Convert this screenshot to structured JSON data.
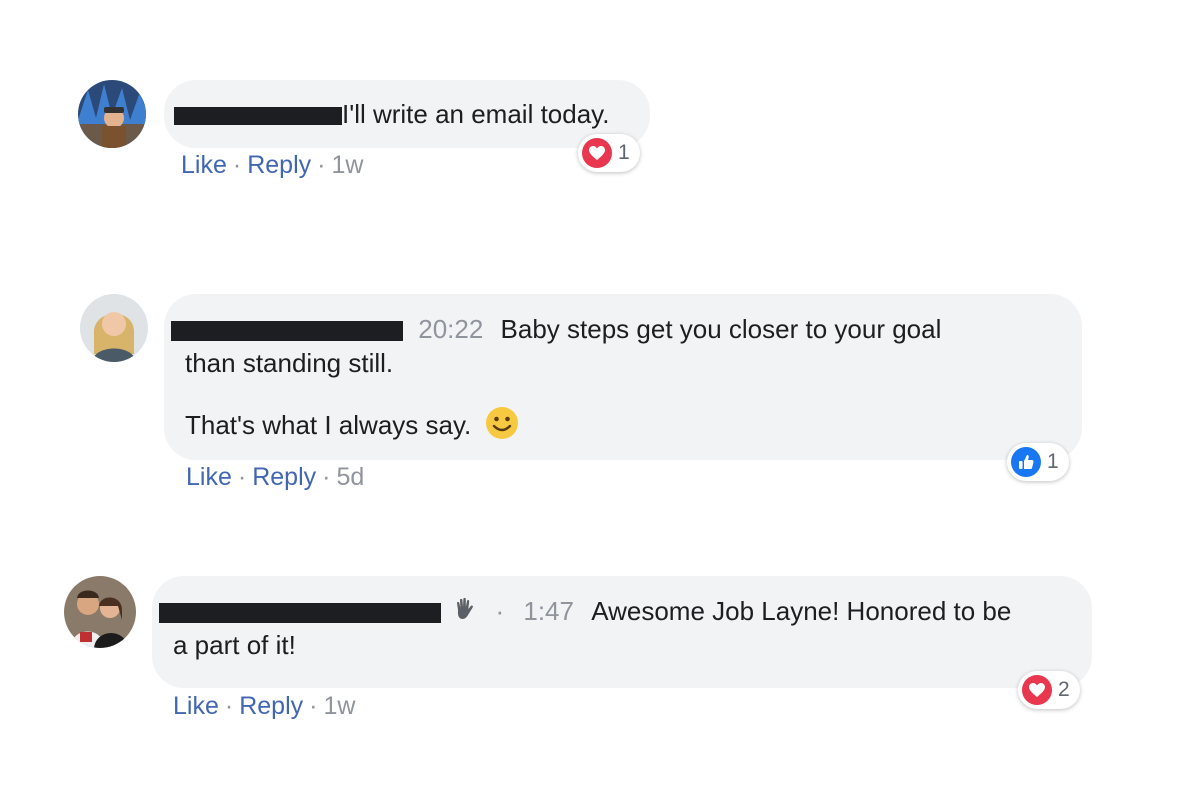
{
  "colors": {
    "bubble_bg": "#f2f3f5",
    "link": "#4267b2",
    "muted": "#90949c",
    "love_red": "#e8374e",
    "like_blue": "#1877f2"
  },
  "comments": [
    {
      "text": "I'll write an email today.",
      "actions": {
        "like": "Like",
        "reply": "Reply",
        "sep": "·",
        "time": "1w"
      },
      "reaction": {
        "icon": "love-icon",
        "count": "1"
      }
    },
    {
      "timestamp": "20:22",
      "text_line1": "Baby steps get you closer to your goal",
      "text_line2": "than standing still.",
      "text_line3": "That's what I always say.",
      "emoji": "slightly-smiling-face-emoji",
      "actions": {
        "like": "Like",
        "reply": "Reply",
        "sep": "·",
        "time": "5d"
      },
      "reaction": {
        "icon": "like-icon",
        "count": "1"
      }
    },
    {
      "badge_icon": "waving-hand-icon",
      "badge_sep": "·",
      "timestamp": "1:47",
      "text_line1": "Awesome Job Layne! Honored to be",
      "text_line2": "a part of it!",
      "actions": {
        "like": "Like",
        "reply": "Reply",
        "sep": "·",
        "time": "1w"
      },
      "reaction": {
        "icon": "love-icon",
        "count": "2"
      }
    }
  ]
}
